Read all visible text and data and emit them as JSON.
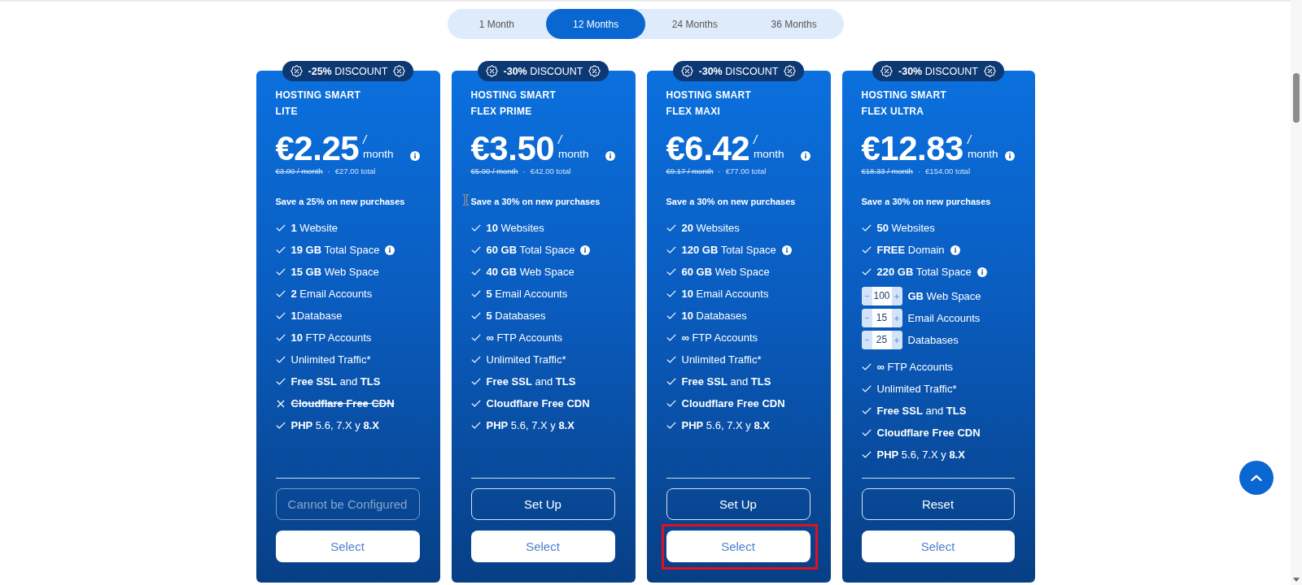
{
  "tabs": [
    {
      "label": "1 Month",
      "selected": false
    },
    {
      "label": "12 Months",
      "selected": true
    },
    {
      "label": "24 Months",
      "selected": false
    },
    {
      "label": "36 Months",
      "selected": false
    }
  ],
  "plans": [
    {
      "badge": "**-25%** DISCOUNT",
      "name_lines": [
        "HOSTING SMART",
        "LITE"
      ],
      "price": "€2.25",
      "per": "/",
      "period": "month",
      "old_price": "€3.00 / month",
      "separator": "·",
      "total": "€27.00 total",
      "save": "Save a 25% on new purchases",
      "cursor": false,
      "features": [
        {
          "kind": "check",
          "text": "**1** Website",
          "included": true
        },
        {
          "kind": "check",
          "text": "**19 GB** Total Space",
          "included": true,
          "info": true
        },
        {
          "kind": "check",
          "text": "**15 GB** Web Space",
          "included": true
        },
        {
          "kind": "check",
          "text": "**2** Email Accounts",
          "included": true
        },
        {
          "kind": "check",
          "text": "**1**Database",
          "included": true
        },
        {
          "kind": "check",
          "text": "**10** FTP Accounts",
          "included": true
        },
        {
          "kind": "check",
          "text": "Unlimited Traffic*",
          "included": true
        },
        {
          "kind": "check",
          "text": "**Free SSL** and **TLS**",
          "included": true
        },
        {
          "kind": "check",
          "text": "Cloudflare Free CDN",
          "included": false,
          "bold": true
        },
        {
          "kind": "check",
          "text": "**PHP** 5.6, 7.X y **8.X**",
          "included": true
        }
      ],
      "action": {
        "label": "Cannot be Configured",
        "disabled": true
      },
      "select": {
        "label": "Select",
        "highlighted": false
      }
    },
    {
      "badge": "**-30%** DISCOUNT",
      "name_lines": [
        "HOSTING SMART",
        "FLEX PRIME"
      ],
      "price": "€3.50",
      "per": "/",
      "period": "month",
      "old_price": "€5.00 / month",
      "separator": "·",
      "total": "€42.00 total",
      "save": "Save a 30% on new purchases",
      "cursor": true,
      "features": [
        {
          "kind": "check",
          "text": "**10** Websites",
          "included": true
        },
        {
          "kind": "check",
          "text": "**60 GB** Total Space",
          "included": true,
          "info": true
        },
        {
          "kind": "check",
          "text": "**40 GB** Web Space",
          "included": true
        },
        {
          "kind": "check",
          "text": "**5** Email Accounts",
          "included": true
        },
        {
          "kind": "check",
          "text": "**5** Databases",
          "included": true
        },
        {
          "kind": "check",
          "text": "**∞** FTP Accounts",
          "included": true
        },
        {
          "kind": "check",
          "text": "Unlimited Traffic*",
          "included": true
        },
        {
          "kind": "check",
          "text": "**Free SSL** and **TLS**",
          "included": true
        },
        {
          "kind": "check",
          "text": "Cloudflare Free CDN",
          "included": true,
          "bold": true
        },
        {
          "kind": "check",
          "text": "**PHP** 5.6, 7.X y **8.X**",
          "included": true
        }
      ],
      "action": {
        "label": "Set Up",
        "disabled": false
      },
      "select": {
        "label": "Select",
        "highlighted": false
      }
    },
    {
      "badge": "**-30%** DISCOUNT",
      "name_lines": [
        "HOSTING SMART",
        "FLEX MAXI"
      ],
      "price": "€6.42",
      "per": "/",
      "period": "month",
      "old_price": "€9.17 / month",
      "separator": "·",
      "total": "€77.00 total",
      "save": "Save a 30% on new purchases",
      "cursor": false,
      "features": [
        {
          "kind": "check",
          "text": "**20** Websites",
          "included": true
        },
        {
          "kind": "check",
          "text": "**120 GB** Total Space",
          "included": true,
          "info": true
        },
        {
          "kind": "check",
          "text": "**60 GB** Web Space",
          "included": true
        },
        {
          "kind": "check",
          "text": "**10** Email Accounts",
          "included": true
        },
        {
          "kind": "check",
          "text": "**10** Databases",
          "included": true
        },
        {
          "kind": "check",
          "text": "**∞** FTP Accounts",
          "included": true
        },
        {
          "kind": "check",
          "text": "Unlimited Traffic*",
          "included": true
        },
        {
          "kind": "check",
          "text": "**Free SSL** and **TLS**",
          "included": true
        },
        {
          "kind": "check",
          "text": "Cloudflare Free CDN",
          "included": true,
          "bold": true
        },
        {
          "kind": "check",
          "text": "**PHP** 5.6, 7.X y **8.X**",
          "included": true
        }
      ],
      "action": {
        "label": "Set Up",
        "disabled": false
      },
      "select": {
        "label": "Select",
        "highlighted": true
      }
    },
    {
      "badge": "**-30%** DISCOUNT",
      "name_lines": [
        "HOSTING SMART",
        "FLEX ULTRA"
      ],
      "price": "€12.83",
      "per": "/",
      "period": "month",
      "old_price": "€18.33 / month",
      "separator": "·",
      "total": "€154.00 total",
      "save": "Save a 30% on new purchases",
      "cursor": false,
      "features": [
        {
          "kind": "check",
          "text": "**50** Websites",
          "included": true
        },
        {
          "kind": "check",
          "text": "**FREE** Domain",
          "included": true,
          "info": true
        },
        {
          "kind": "check",
          "text": "**220 GB** Total Space",
          "included": true,
          "info": true
        },
        {
          "kind": "stepper",
          "value": "100",
          "text": "**GB** Web Space"
        },
        {
          "kind": "stepper",
          "value": "15",
          "text": "Email Accounts"
        },
        {
          "kind": "stepper",
          "value": "25",
          "text": "Databases"
        },
        {
          "kind": "check",
          "text": "**∞** FTP Accounts",
          "included": true
        },
        {
          "kind": "check",
          "text": "Unlimited Traffic*",
          "included": true
        },
        {
          "kind": "check",
          "text": "**Free SSL** and **TLS**",
          "included": true
        },
        {
          "kind": "check",
          "text": "Cloudflare Free CDN",
          "included": true,
          "bold": true
        },
        {
          "kind": "check",
          "text": "**PHP** 5.6, 7.X y **8.X**",
          "included": true
        }
      ],
      "action": {
        "label": "Reset",
        "disabled": false
      },
      "select": {
        "label": "Select",
        "highlighted": false
      }
    }
  ]
}
